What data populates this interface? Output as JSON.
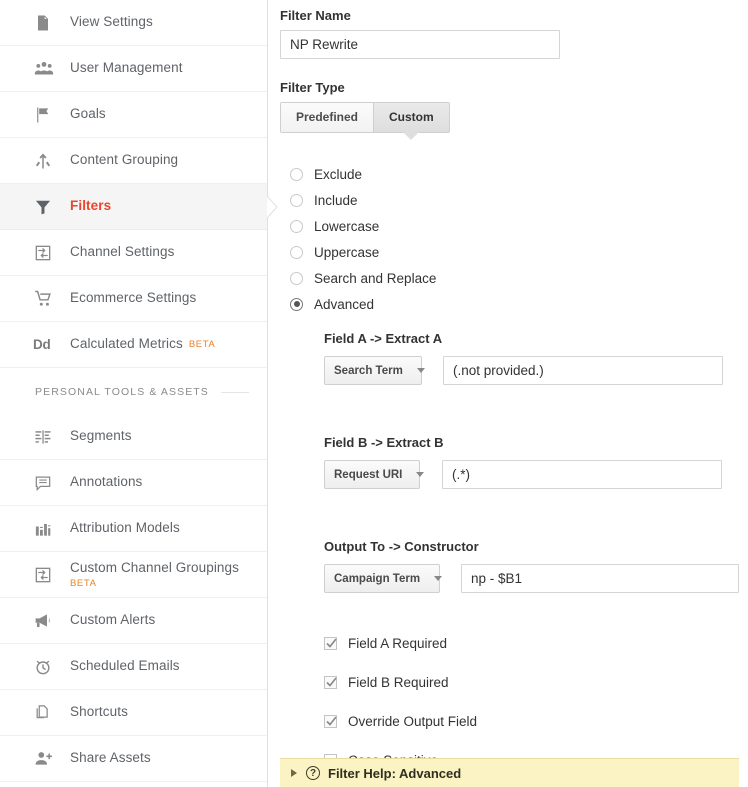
{
  "sidebar": {
    "primary_items": [
      {
        "label": "View Settings",
        "icon": "document-icon",
        "selected": false
      },
      {
        "label": "User Management",
        "icon": "people-icon",
        "selected": false
      },
      {
        "label": "Goals",
        "icon": "flag-icon",
        "selected": false
      },
      {
        "label": "Content Grouping",
        "icon": "content-grouping-icon",
        "selected": false
      },
      {
        "label": "Filters",
        "icon": "funnel-icon",
        "selected": true
      },
      {
        "label": "Channel Settings",
        "icon": "channel-settings-icon",
        "selected": false
      },
      {
        "label": "Ecommerce Settings",
        "icon": "shopping-cart-icon",
        "selected": false
      },
      {
        "label": "Calculated Metrics",
        "icon": "dd-icon",
        "badge": "BETA",
        "selected": false
      }
    ],
    "section_title": "PERSONAL TOOLS & ASSETS",
    "secondary_items": [
      {
        "label": "Segments",
        "icon": "segments-icon",
        "selected": false
      },
      {
        "label": "Annotations",
        "icon": "annotations-icon",
        "selected": false
      },
      {
        "label": "Attribution Models",
        "icon": "bar-chart-icon",
        "selected": false
      },
      {
        "label": "Custom Channel Groupings",
        "icon": "channel-settings-icon",
        "badge": "BETA",
        "selected": false
      },
      {
        "label": "Custom Alerts",
        "icon": "megaphone-icon",
        "selected": false
      },
      {
        "label": "Scheduled Emails",
        "icon": "alarm-clock-icon",
        "selected": false
      },
      {
        "label": "Shortcuts",
        "icon": "copy-page-icon",
        "selected": false
      },
      {
        "label": "Share Assets",
        "icon": "person-add-icon",
        "selected": false
      }
    ],
    "selected_color": "#e8452c",
    "badge_color": "#e8832a"
  },
  "form": {
    "filter_name": {
      "label": "Filter Name",
      "value": "NP Rewrite",
      "placeholder": ""
    },
    "filter_type": {
      "label": "Filter Type",
      "tabs": [
        {
          "label": "Predefined",
          "active": false
        },
        {
          "label": "Custom",
          "active": true
        }
      ]
    },
    "filter_options": [
      {
        "label": "Exclude",
        "selected": false
      },
      {
        "label": "Include",
        "selected": false
      },
      {
        "label": "Lowercase",
        "selected": false
      },
      {
        "label": "Uppercase",
        "selected": false
      },
      {
        "label": "Search and Replace",
        "selected": false
      },
      {
        "label": "Advanced",
        "selected": true
      }
    ],
    "field_a": {
      "heading": "Field A -> Extract A",
      "select_value": "Search Term",
      "input_value": "(.not provided.)",
      "placeholder": ""
    },
    "field_b": {
      "heading": "Field B -> Extract B",
      "select_value": "Request URI",
      "input_value": "(.*)",
      "placeholder": ""
    },
    "output_to": {
      "heading": "Output To -> Constructor",
      "select_value": "Campaign Term",
      "input_value": "np - $B1",
      "placeholder": ""
    },
    "checkboxes": [
      {
        "label": "Field A Required",
        "checked": true
      },
      {
        "label": "Field B Required",
        "checked": true
      },
      {
        "label": "Override Output Field",
        "checked": true
      },
      {
        "label": "Case Sensitive",
        "checked": false
      }
    ]
  },
  "help_bar": {
    "text": "Filter Help: Advanced",
    "expanded": false,
    "background": "#fbf3c4"
  }
}
